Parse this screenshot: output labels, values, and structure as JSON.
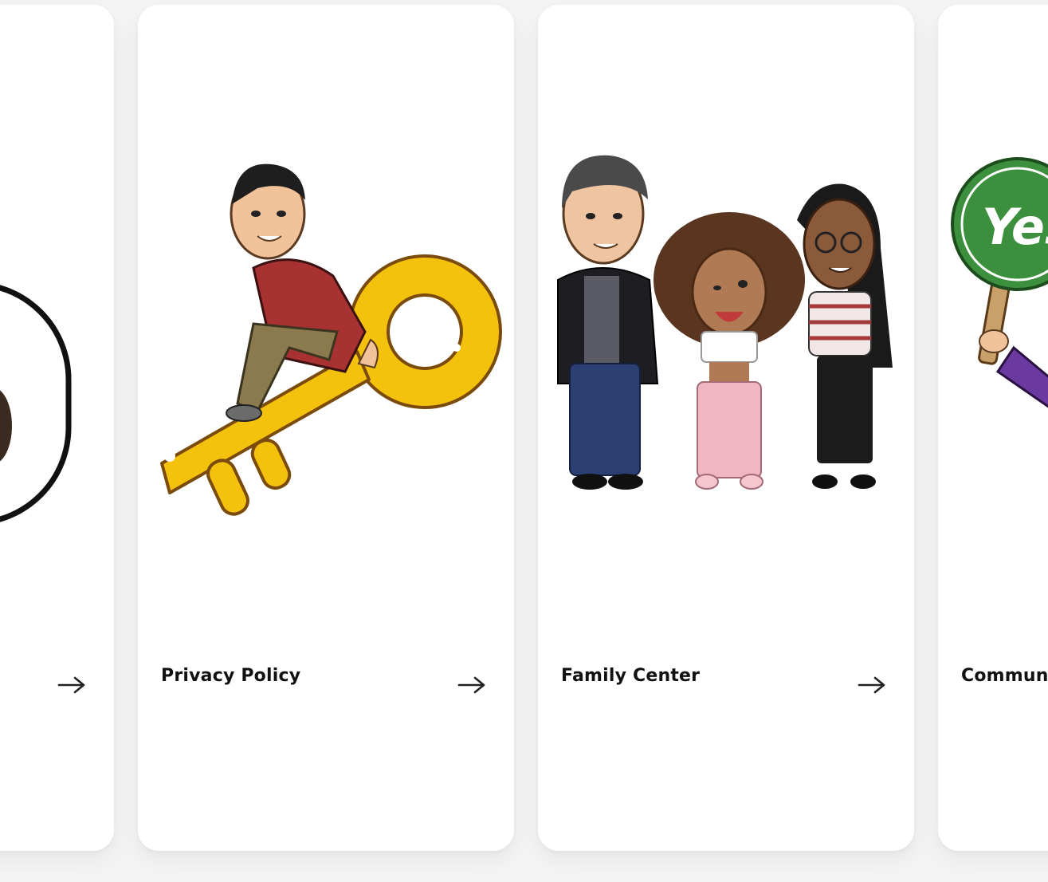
{
  "cards": [
    {
      "title": "",
      "arrow_icon": "arrow-right-icon",
      "illustration": "bitmoji-rounded-frame-icon"
    },
    {
      "title": "Privacy Policy",
      "arrow_icon": "arrow-right-icon",
      "illustration": "bitmoji-sitting-on-golden-key"
    },
    {
      "title": "Family Center",
      "arrow_icon": "arrow-right-icon",
      "illustration": "bitmoji-family-group"
    },
    {
      "title": "Commun",
      "arrow_icon": "arrow-right-icon",
      "illustration": "bitmoji-holding-yes-sign"
    }
  ],
  "colors": {
    "page_background": "#f4f4f5",
    "card_background": "#ffffff",
    "title_text": "#111111",
    "arrow": "#222222",
    "key_gold": "#f4c20d",
    "yes_sign_green": "#3c8f3c"
  }
}
